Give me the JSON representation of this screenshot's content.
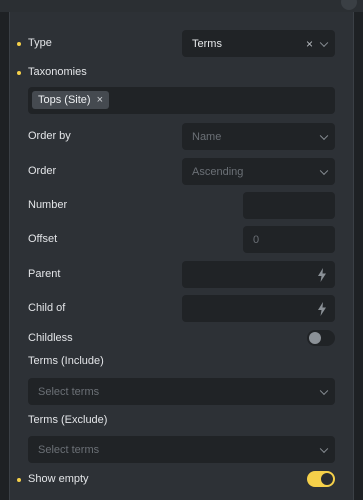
{
  "fields": {
    "type": {
      "label": "Type",
      "value": "Terms"
    },
    "taxonomies": {
      "label": "Taxonomies",
      "tag": "Tops (Site)"
    },
    "order_by": {
      "label": "Order by",
      "placeholder": "Name"
    },
    "order": {
      "label": "Order",
      "placeholder": "Ascending"
    },
    "number": {
      "label": "Number",
      "value": ""
    },
    "offset": {
      "label": "Offset",
      "placeholder": "0"
    },
    "parent": {
      "label": "Parent"
    },
    "child_of": {
      "label": "Child of"
    },
    "childless": {
      "label": "Childless",
      "enabled": false
    },
    "terms_include": {
      "label": "Terms (Include)",
      "placeholder": "Select terms"
    },
    "terms_exclude": {
      "label": "Terms (Exclude)",
      "placeholder": "Select terms"
    },
    "show_empty": {
      "label": "Show empty",
      "enabled": true
    }
  },
  "icons": {
    "clear": "×",
    "dynamic_data": "bolt-icon",
    "dropdown": "chevron-down-icon"
  },
  "colors": {
    "accent": "#f5d04a",
    "panel_bg": "#2d3136",
    "control_bg": "#202326"
  }
}
